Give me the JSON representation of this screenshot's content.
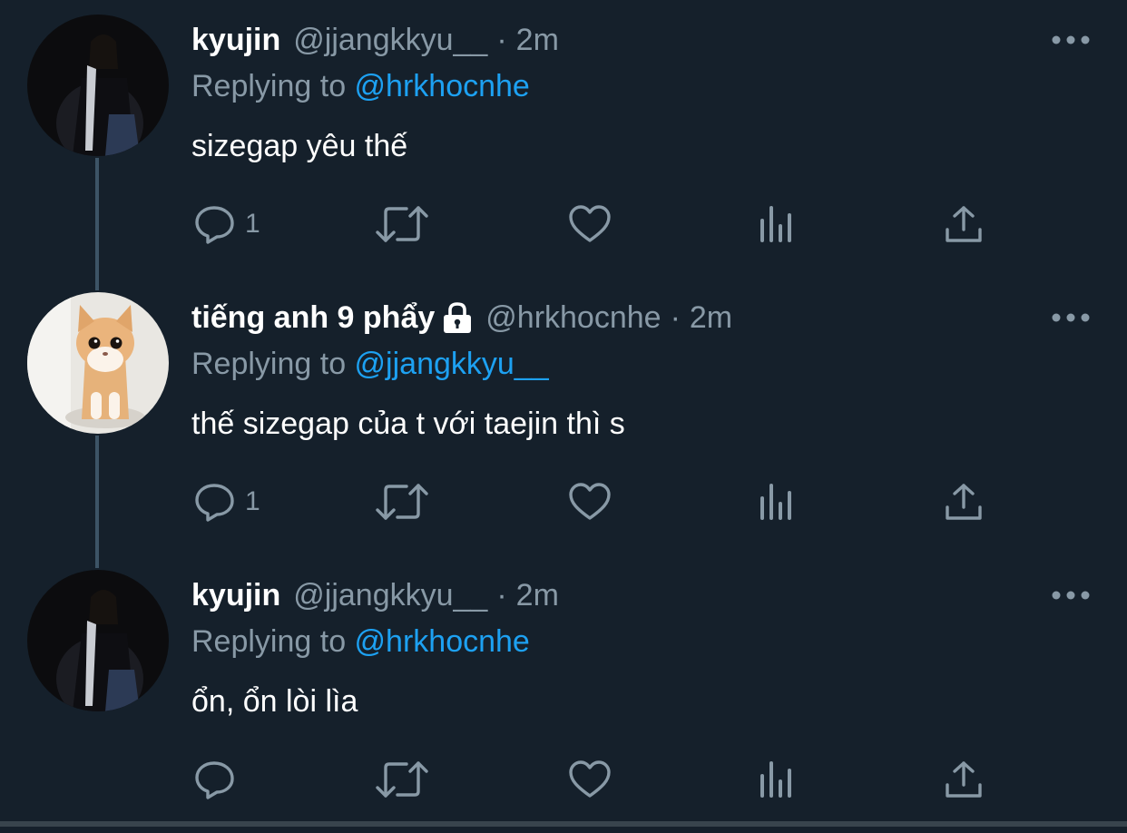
{
  "colors": {
    "background": "#15202b",
    "primary_text": "#ffffff",
    "secondary_text": "#8899a6",
    "link": "#1da1f2",
    "thread_line": "#3d5466"
  },
  "tweets": [
    {
      "display_name": "kyujin",
      "handle": "@jjangkkyu__",
      "time": "2m",
      "replying_prefix": "Replying to ",
      "replying_to": "@hrkhocnhe",
      "text": "sizegap yêu thế",
      "reply_count": "1",
      "protected": false,
      "avatar": "dark-photo-avatar"
    },
    {
      "display_name": "tiếng anh 9 phẩy",
      "handle": "@hrkhocnhe",
      "time": "2m",
      "replying_prefix": "Replying to ",
      "replying_to": "@jjangkkyu__",
      "text": "thế sizegap của t với taejin thì s",
      "reply_count": "1",
      "protected": true,
      "avatar": "kitten-photo-avatar"
    },
    {
      "display_name": "kyujin",
      "handle": "@jjangkkyu__",
      "time": "2m",
      "replying_prefix": "Replying to ",
      "replying_to": "@hrkhocnhe",
      "text": "ổn, ổn lòi lìa",
      "reply_count": "",
      "protected": false,
      "avatar": "dark-photo-avatar"
    }
  ],
  "separator": "·",
  "icons": [
    "reply-icon",
    "retweet-icon",
    "like-icon",
    "analytics-icon",
    "share-icon",
    "more-icon",
    "lock-icon"
  ]
}
